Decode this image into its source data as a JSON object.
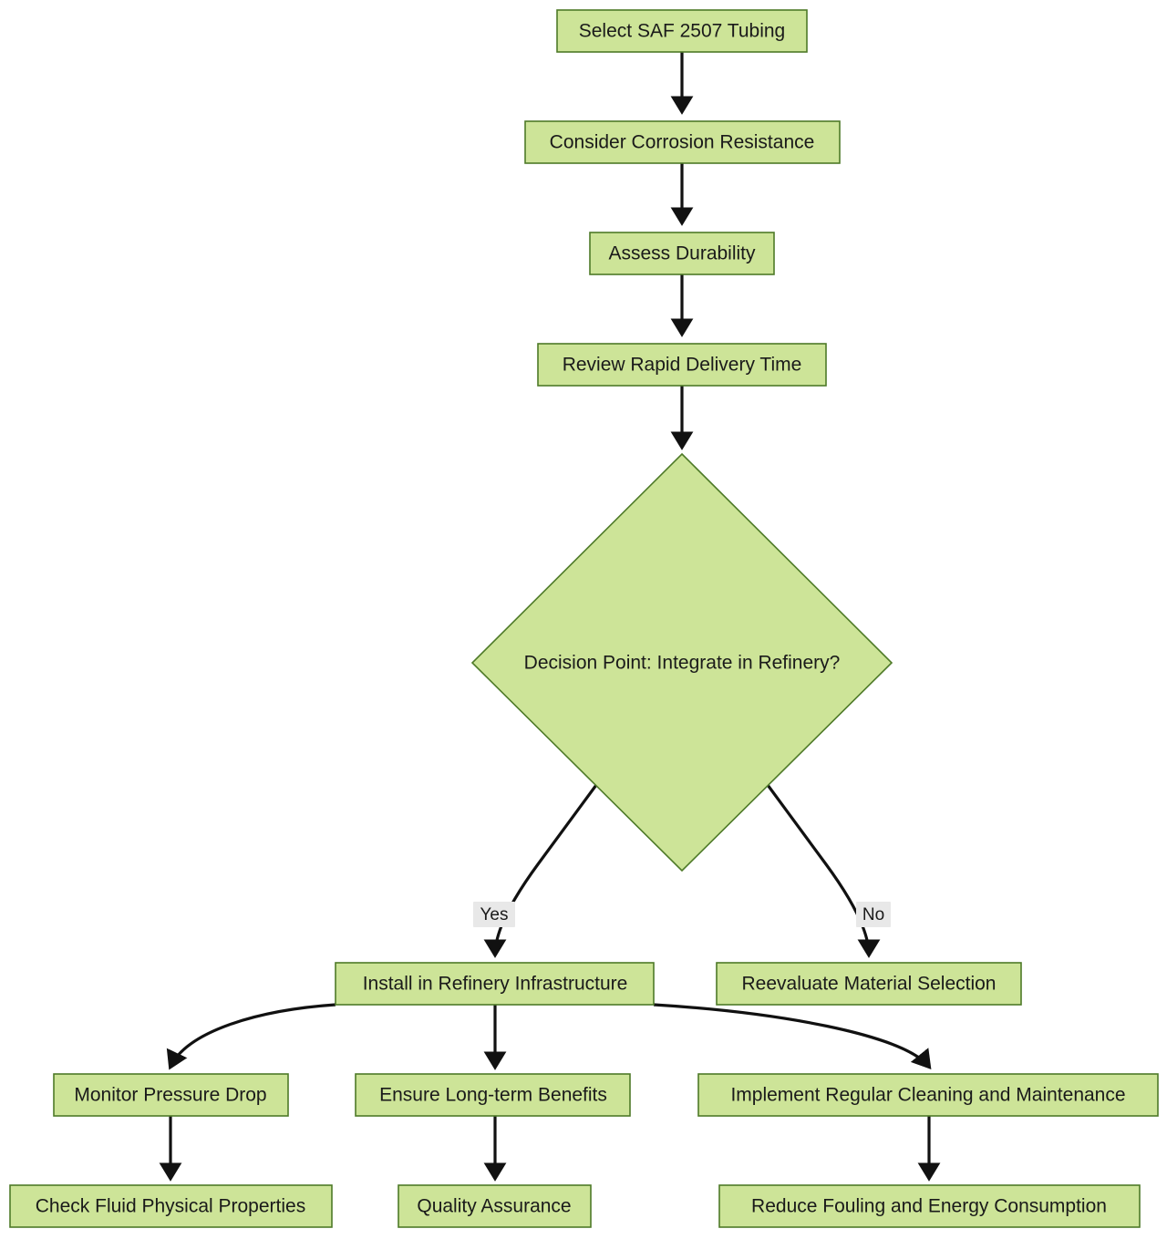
{
  "diagram": {
    "type": "flowchart",
    "direction": "top-down",
    "theme": {
      "node_fill": "#cde498",
      "node_stroke": "#4e7a28",
      "edge_color": "#111111",
      "edge_label_bg": "#e8e8e8",
      "text_color": "#1a1a1a",
      "canvas_bg": "#ffffff"
    },
    "nodes": [
      {
        "id": "n1",
        "shape": "rect",
        "label": "Select SAF 2507 Tubing"
      },
      {
        "id": "n2",
        "shape": "rect",
        "label": "Consider Corrosion Resistance"
      },
      {
        "id": "n3",
        "shape": "rect",
        "label": "Assess Durability"
      },
      {
        "id": "n4",
        "shape": "rect",
        "label": "Review Rapid Delivery Time"
      },
      {
        "id": "n5",
        "shape": "diamond",
        "label": "Decision Point: Integrate in Refinery?"
      },
      {
        "id": "n6",
        "shape": "rect",
        "label": "Install in Refinery Infrastructure"
      },
      {
        "id": "n7",
        "shape": "rect",
        "label": "Reevaluate Material Selection"
      },
      {
        "id": "n8",
        "shape": "rect",
        "label": "Monitor Pressure Drop"
      },
      {
        "id": "n9",
        "shape": "rect",
        "label": "Ensure Long-term Benefits"
      },
      {
        "id": "n10",
        "shape": "rect",
        "label": "Implement Regular Cleaning and Maintenance"
      },
      {
        "id": "n11",
        "shape": "rect",
        "label": "Check Fluid Physical Properties"
      },
      {
        "id": "n12",
        "shape": "rect",
        "label": "Quality Assurance"
      },
      {
        "id": "n13",
        "shape": "rect",
        "label": "Reduce Fouling and Energy Consumption"
      }
    ],
    "edges": [
      {
        "from": "n1",
        "to": "n2",
        "label": ""
      },
      {
        "from": "n2",
        "to": "n3",
        "label": ""
      },
      {
        "from": "n3",
        "to": "n4",
        "label": ""
      },
      {
        "from": "n4",
        "to": "n5",
        "label": ""
      },
      {
        "from": "n5",
        "to": "n6",
        "label": "Yes"
      },
      {
        "from": "n5",
        "to": "n7",
        "label": "No"
      },
      {
        "from": "n6",
        "to": "n8",
        "label": ""
      },
      {
        "from": "n6",
        "to": "n9",
        "label": ""
      },
      {
        "from": "n6",
        "to": "n10",
        "label": ""
      },
      {
        "from": "n8",
        "to": "n11",
        "label": ""
      },
      {
        "from": "n9",
        "to": "n12",
        "label": ""
      },
      {
        "from": "n10",
        "to": "n13",
        "label": ""
      }
    ],
    "edge_labels": {
      "yes": "Yes",
      "no": "No"
    }
  }
}
